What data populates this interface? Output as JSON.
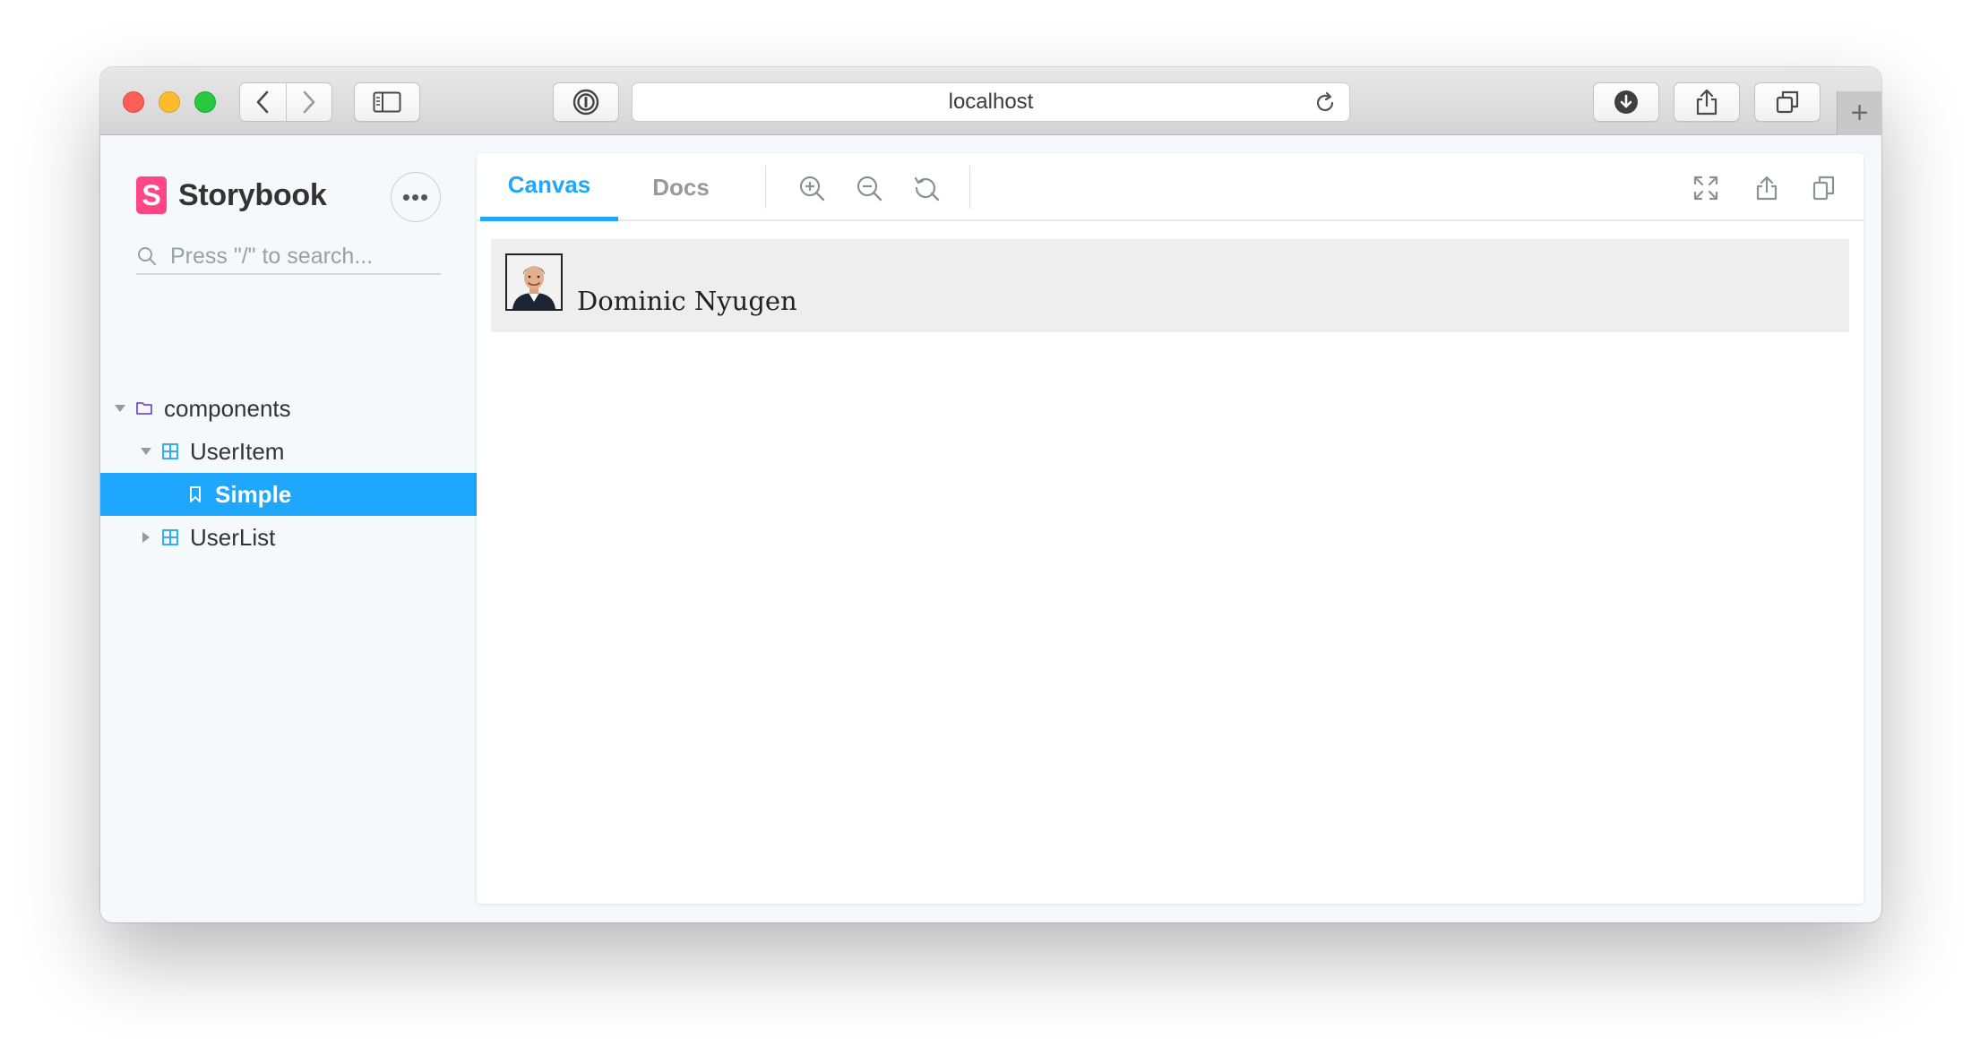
{
  "browser": {
    "url": "localhost",
    "new_tab_label": "+"
  },
  "sidebar": {
    "brand": "Storybook",
    "brand_letter": "S",
    "menu_label": "•••",
    "search_placeholder": "Press \"/\" to search...",
    "tree": [
      {
        "label": "components",
        "type": "folder",
        "expanded": true
      },
      {
        "label": "UserItem",
        "type": "component",
        "expanded": true
      },
      {
        "label": "Simple",
        "type": "story",
        "selected": true
      },
      {
        "label": "UserList",
        "type": "component",
        "expanded": false
      }
    ]
  },
  "panel": {
    "tabs": [
      {
        "label": "Canvas",
        "active": true
      },
      {
        "label": "Docs",
        "active": false
      }
    ]
  },
  "preview": {
    "user_name": "Dominic Nyugen"
  },
  "colors": {
    "accent": "#1ea7fd",
    "brand": "#ff4785",
    "sidebar_bg": "#f6f9fc",
    "canvas_bg": "#eeeeee"
  },
  "icons": {
    "zoom_in": "zoom-in-icon",
    "zoom_out": "zoom-out-icon",
    "zoom_reset": "zoom-reset-icon",
    "fullscreen": "fullscreen-icon",
    "share": "share-icon",
    "copy": "copy-icon"
  }
}
